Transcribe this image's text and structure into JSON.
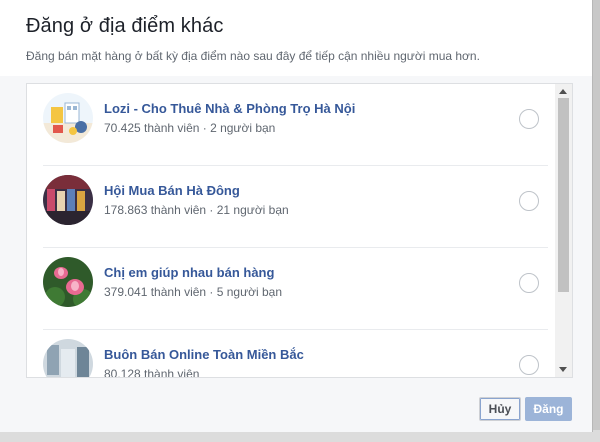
{
  "dialog": {
    "title": "Đăng ở địa điểm khác",
    "subtitle": "Đăng bán mặt hàng ở bất kỳ địa điểm nào sau đây để tiếp cận nhiều người mua hơn."
  },
  "groups": [
    {
      "name": "Lozi - Cho Thuê Nhà & Phòng Trọ Hà Nội",
      "meta": "70.425 thành viên · 2 người bạn",
      "selected": false
    },
    {
      "name": "Hội Mua Bán Hà Đông",
      "meta": "178.863 thành viên · 21 người bạn",
      "selected": false
    },
    {
      "name": "Chị em giúp nhau bán hàng",
      "meta": "379.041 thành viên · 5 người bạn",
      "selected": false
    },
    {
      "name": "Buôn Bán Online Toàn Miền Bắc",
      "meta": "80.128 thành viên",
      "selected": false
    }
  ],
  "buttons": {
    "cancel_label": "Hủy",
    "post_label": "Đăng"
  },
  "colors": {
    "link": "#365899",
    "primary_disabled": "#9cb4d8"
  }
}
